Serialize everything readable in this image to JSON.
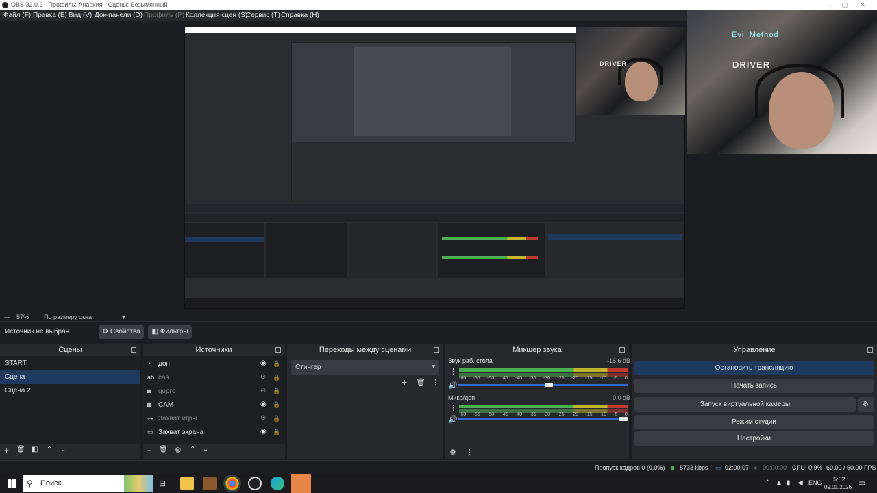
{
  "titlebar": {
    "title": "OBS 32.0.2 - Профиль: Анархия - Сцены: Безымянный"
  },
  "menu": [
    {
      "label": "Файл (F)",
      "disabled": false
    },
    {
      "label": "Правка (E)",
      "disabled": false
    },
    {
      "label": "Вид (V)",
      "disabled": false
    },
    {
      "label": "Док-панели (D)",
      "disabled": false
    },
    {
      "label": "Профиль (P)",
      "disabled": true
    },
    {
      "label": "Коллекция сцен (S)",
      "disabled": false
    },
    {
      "label": "Сервис (T)",
      "disabled": false
    },
    {
      "label": "Справка (H)",
      "disabled": false
    }
  ],
  "preview": {
    "cam_label": "DRIVER",
    "cam_label2": "Evil Method"
  },
  "zoom": {
    "value": "57%",
    "mode": "По размеру окна"
  },
  "source_bar": {
    "no_source": "Источник не выбран",
    "properties": "Свойства",
    "filters": "Фильтры"
  },
  "scenes": {
    "title": "Сцены",
    "items": [
      {
        "label": "START",
        "selected": false
      },
      {
        "label": "Сцена",
        "selected": true
      },
      {
        "label": "Сцена 2",
        "selected": false
      }
    ]
  },
  "sources": {
    "title": "Источники",
    "items": [
      {
        "label": "дон",
        "icon": "audio-source-icon",
        "visible": true
      },
      {
        "label": "cas",
        "icon": "text-source-icon",
        "visible": false
      },
      {
        "label": "gopro",
        "icon": "camera-icon",
        "visible": false
      },
      {
        "label": "CAM",
        "icon": "camera-icon",
        "visible": true
      },
      {
        "label": "Захват игры",
        "icon": "gamepad-icon",
        "visible": false
      },
      {
        "label": "Захват экрана",
        "icon": "monitor-icon",
        "visible": true
      }
    ]
  },
  "transitions": {
    "title": "Переходы между сценами",
    "selected": "Стингер"
  },
  "mixer": {
    "title": "Микшер звука",
    "channels": [
      {
        "name": "Звук раб. стола",
        "db": "-16.6 dB",
        "level": 0.68,
        "volume": 0.52
      },
      {
        "name": "Микр/доп",
        "db": "0.0 dB",
        "level": 0.13,
        "volume": 1.0
      }
    ],
    "ticks": [
      "-60",
      "-55",
      "-50",
      "-45",
      "-40",
      "-35",
      "-30",
      "-25",
      "-20",
      "-15",
      "-10",
      "-5",
      "0"
    ]
  },
  "controls": {
    "title": "Управление",
    "stop_stream": "Остановить трансляцию",
    "start_record": "Начать запись",
    "virtual_cam": "Запуск виртуальной камеры",
    "studio_mode": "Режим студии",
    "settings": "Настройки"
  },
  "status": {
    "dropped": "Пропуск кадров 0 (0.0%)",
    "bitrate": "5733 kbps",
    "stream_time": "02:00:07",
    "rec_time": "00:00:00",
    "cpu": "CPU: 0.9%",
    "fps": "60.00 / 60.00 FPS"
  },
  "taskbar": {
    "search": "Поиск",
    "lang": "ENG",
    "time": "5:02",
    "date": "09.01.2026"
  },
  "colors": {
    "accent": "#1f3a5f",
    "panel": "#27282c",
    "bg": "#1c1d21"
  }
}
